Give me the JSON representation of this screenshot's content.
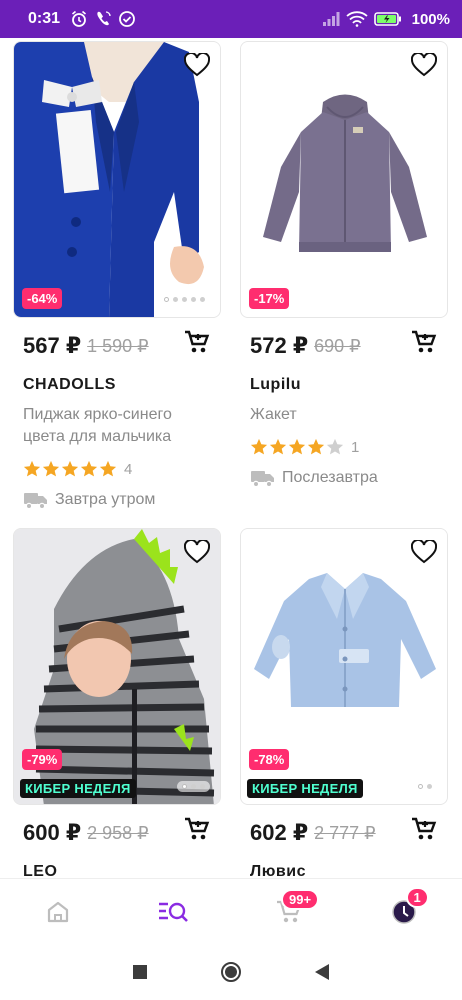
{
  "status_bar": {
    "time": "0:31",
    "battery_percent": "100%"
  },
  "products": [
    {
      "price": "567 ₽",
      "old_price": "1 590 ₽",
      "discount": "-64%",
      "brand": "CHADOLLS",
      "description": "Пиджак ярко-синего цвета для мальчика",
      "rating_stars": 5,
      "reviews": "4",
      "delivery": "Завтра утром",
      "badge": ""
    },
    {
      "price": "572 ₽",
      "old_price": "690 ₽",
      "discount": "-17%",
      "brand": "Lupilu",
      "description": "Жакет",
      "rating_stars": 4,
      "reviews": "1",
      "delivery": "Послезавтра",
      "badge": ""
    },
    {
      "price": "600 ₽",
      "old_price": "2 958 ₽",
      "discount": "-79%",
      "brand": "LEO",
      "badge": "КИБЕР НЕДЕЛЯ"
    },
    {
      "price": "602 ₽",
      "old_price": "2 777 ₽",
      "discount": "-78%",
      "brand": "Лювис",
      "badge": "КИБЕР НЕДЕЛЯ"
    }
  ],
  "bottom_nav": {
    "cart_badge": "99+",
    "profile_badge": "1",
    "active_tab": "catalog",
    "accent_color": "#8a2be2"
  },
  "colors": {
    "status_bar": "#6b1fb8",
    "discount": "#ff2d6f",
    "star": "#f5a623",
    "cyber_text": "#4fffd0"
  }
}
